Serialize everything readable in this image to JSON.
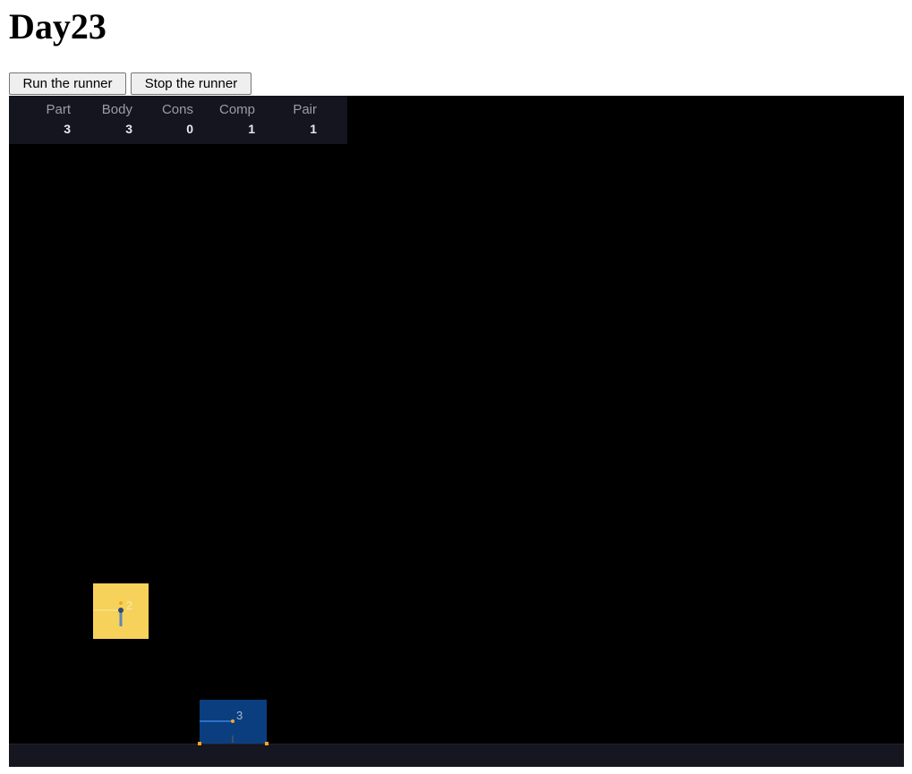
{
  "page": {
    "title": "Day23"
  },
  "controls": {
    "run_label": "Run the runner",
    "stop_label": "Stop the runner"
  },
  "stats": {
    "part": {
      "label": "Part",
      "value": "3"
    },
    "body": {
      "label": "Body",
      "value": "3"
    },
    "cons": {
      "label": "Cons",
      "value": "0"
    },
    "comp": {
      "label": "Comp",
      "value": "1"
    },
    "pair": {
      "label": "Pair",
      "value": "1"
    }
  },
  "bodies": [
    {
      "id": "2",
      "color": "#f6d25a"
    },
    {
      "id": "3",
      "color": "#0a3e7f"
    }
  ],
  "colors": {
    "canvas_background": "#000000",
    "stats_background": "#14151f",
    "ground": "#15161f",
    "contact_points": "#f5a623"
  }
}
